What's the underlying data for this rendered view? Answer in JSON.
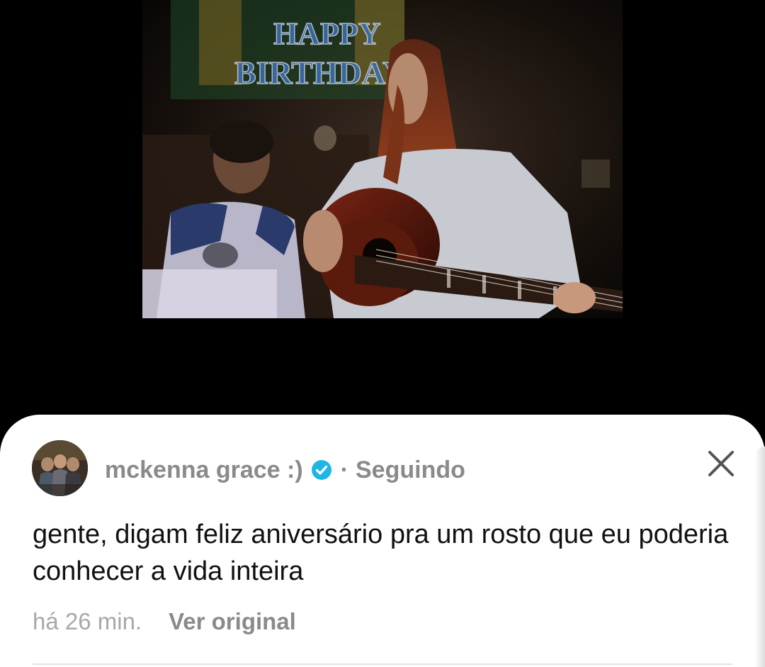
{
  "video": {
    "banner_line1": "HAPPY",
    "banner_line2": "BIRTHDAY"
  },
  "post": {
    "author_name": "mckenna grace :)",
    "separator": "·",
    "follow_status": "Seguindo",
    "text": "gente, digam feliz aniversário pra um rosto que eu poderia conhecer a vida inteira",
    "timestamp": "há 26 min.",
    "translate_label": "Ver original"
  },
  "icons": {
    "verified": "verified-badge-icon",
    "close": "close-icon"
  },
  "colors": {
    "verified_blue": "#1fb6e6",
    "muted_text": "#8a8a8a",
    "body_text": "#111111"
  }
}
